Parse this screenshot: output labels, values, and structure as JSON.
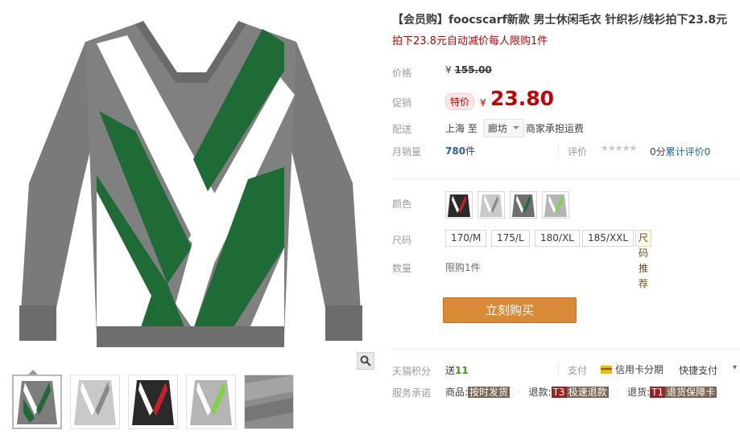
{
  "product": {
    "title": "【会员购】foocscarf新款 男士休闲毛衣 针织衫/线衫拍下23.8元",
    "subtitle": "拍下23.8元自动减价每人限购1件"
  },
  "price": {
    "label": "价格",
    "currency": "¥",
    "original": "155.00"
  },
  "promo": {
    "label": "促销",
    "badge": "特价",
    "currency": "¥",
    "price": "23.80"
  },
  "shipping": {
    "label": "配送",
    "from": "上海 至",
    "to": "廊坊",
    "note": "商家承担运费"
  },
  "sales": {
    "label": "月销量",
    "count": "780",
    "unit": "件",
    "rating_label": "评价",
    "stars": "★★★★★",
    "score": "0分",
    "total_reviews": "累计评价0"
  },
  "options": {
    "color_label": "颜色",
    "size_label": "尺码",
    "sizes": [
      "170/M",
      "175/L",
      "180/XL",
      "185/XXL"
    ],
    "size_guide": "尺码推荐",
    "qty_label": "数量",
    "qty_limit": "限购1件"
  },
  "buy_label": "立刻购买",
  "services": {
    "points_label": "天猫积分",
    "points_prefix": "送",
    "points_value": "11",
    "pay_label": "支付",
    "pay_credit": "信用卡分期",
    "pay_quick": "快捷支付",
    "more_icon": "chevron-down-icon",
    "promise_label": "服务承诺",
    "goods_label": "商品:",
    "goods_tag": "按时发货",
    "refund_label": "退款:",
    "refund_code": "T3",
    "refund_tag": "极速退款",
    "return_label": "退货:",
    "return_code": "T1",
    "return_tag": "退货保障卡"
  },
  "colors": {
    "price_red": "#c40000",
    "buy_button": "#d98a37",
    "link_blue": "#28649b",
    "sweater_grey": "#7d7d7d",
    "sweater_green": "#1e6b36"
  },
  "icons": {
    "zoom": "magnifier-icon",
    "card": "credit-card-icon"
  }
}
